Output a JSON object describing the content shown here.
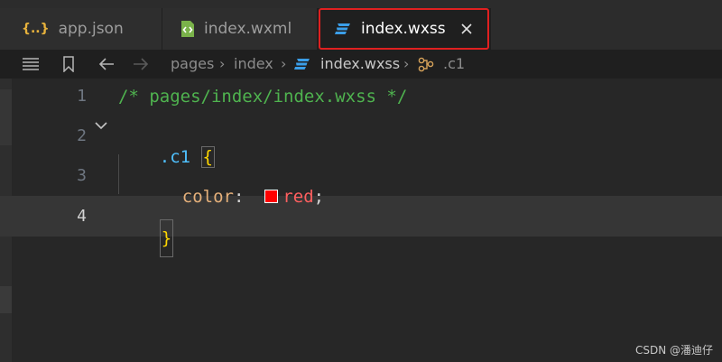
{
  "tabs": [
    {
      "label": "app.json",
      "icon": "json-braces-icon",
      "icon_text": "{..}",
      "active": false
    },
    {
      "label": "index.wxml",
      "icon": "wxml-file-icon",
      "active": false
    },
    {
      "label": "index.wxss",
      "icon": "css-file-icon",
      "active": true
    }
  ],
  "breadcrumb": {
    "items": [
      "pages",
      "index",
      "index.wxss",
      ".c1"
    ],
    "separator": "›"
  },
  "editor": {
    "line_numbers": [
      "1",
      "2",
      "3",
      "4"
    ],
    "lines": [
      {
        "comment": "/* pages/index/index.wxss */"
      },
      {
        "selector": ".c1 ",
        "brace": "{"
      },
      {
        "property": "color",
        "colon": ":",
        "value": "red",
        "semi": ";"
      },
      {
        "brace": "}"
      }
    ],
    "active_line": 4,
    "swatch_color": "#ff0000"
  },
  "watermark": "CSDN @潘迪仔",
  "colors": {
    "comment": "#4fb34f",
    "selector": "#4fc1ff",
    "brace": "#ffd700",
    "property": "#e5b07a",
    "value": "#ff5f5f",
    "highlight_border": "#e02020"
  }
}
